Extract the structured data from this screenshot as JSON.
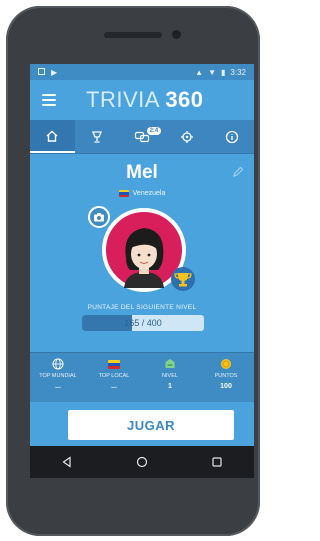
{
  "status_bar": {
    "time": "3:32"
  },
  "app_bar": {
    "title_light": "TRIVIA",
    "title_bold": "360"
  },
  "tabs": [
    {
      "icon": "home-icon",
      "active": true
    },
    {
      "icon": "trophy-icon",
      "active": false
    },
    {
      "icon": "chat-icon",
      "badge": "2:4",
      "active": false
    },
    {
      "icon": "gear-icon",
      "active": false
    },
    {
      "icon": "info-icon",
      "active": false
    }
  ],
  "profile": {
    "username": "Mel",
    "country": "Venezuela",
    "progress_label": "PUNTAJE DEL SIGUIENTE NIVEL",
    "progress_text": "165 / 400",
    "progress_current": 165,
    "progress_max": 400
  },
  "stats": [
    {
      "label": "TOP MUNDIAL",
      "value": "...",
      "icon": "globe-icon"
    },
    {
      "label": "TOP LOCAL",
      "value": "...",
      "icon": "flag-icon"
    },
    {
      "label": "NIVEL",
      "value": "1",
      "icon": "level-icon"
    },
    {
      "label": "PUNTOS",
      "value": "100",
      "icon": "coin-icon"
    }
  ],
  "play_button": {
    "label": "JUGAR"
  },
  "colors": {
    "primary": "#4aa3dc",
    "primary_dark": "#3f8cc4",
    "avatar_ring": "#d91f5b",
    "flag_yellow": "#f4cf1b",
    "flag_blue": "#2353b6",
    "flag_red": "#d32a2a"
  }
}
